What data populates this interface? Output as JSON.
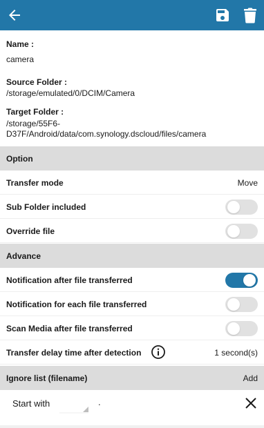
{
  "colors": {
    "accent": "#2277a8",
    "section_bg": "#dcdcdc",
    "toggle_off": "#e1e1e1"
  },
  "topbar": {
    "back_icon": "arrow-left-icon",
    "save_icon": "save-icon",
    "delete_icon": "trash-icon"
  },
  "details": {
    "name_label": "Name :",
    "name_value": "camera",
    "source_label": "Source Folder :",
    "source_value": "/storage/emulated/0/DCIM/Camera",
    "target_label": "Target Folder :",
    "target_value": "/storage/55F6-D37F/Android/data/com.synology.dscloud/files/camera"
  },
  "option": {
    "header": "Option",
    "transfer_mode_label": "Transfer mode",
    "transfer_mode_value": "Move",
    "sub_folder_label": "Sub Folder included",
    "sub_folder_on": false,
    "override_label": "Override file",
    "override_on": false
  },
  "advance": {
    "header": "Advance",
    "notify_after_label": "Notification after file transferred",
    "notify_after_on": true,
    "notify_each_label": "Notification for each file transferred",
    "notify_each_on": false,
    "scan_media_label": "Scan Media after file transferred",
    "scan_media_on": false,
    "delay_label": "Transfer delay time after detection",
    "delay_value": "1 second(s)",
    "info_icon": "info-icon"
  },
  "ignore": {
    "header": "Ignore list (filename)",
    "add_label": "Add",
    "mode": "Start with",
    "value": ".",
    "close_icon": "close-icon"
  }
}
